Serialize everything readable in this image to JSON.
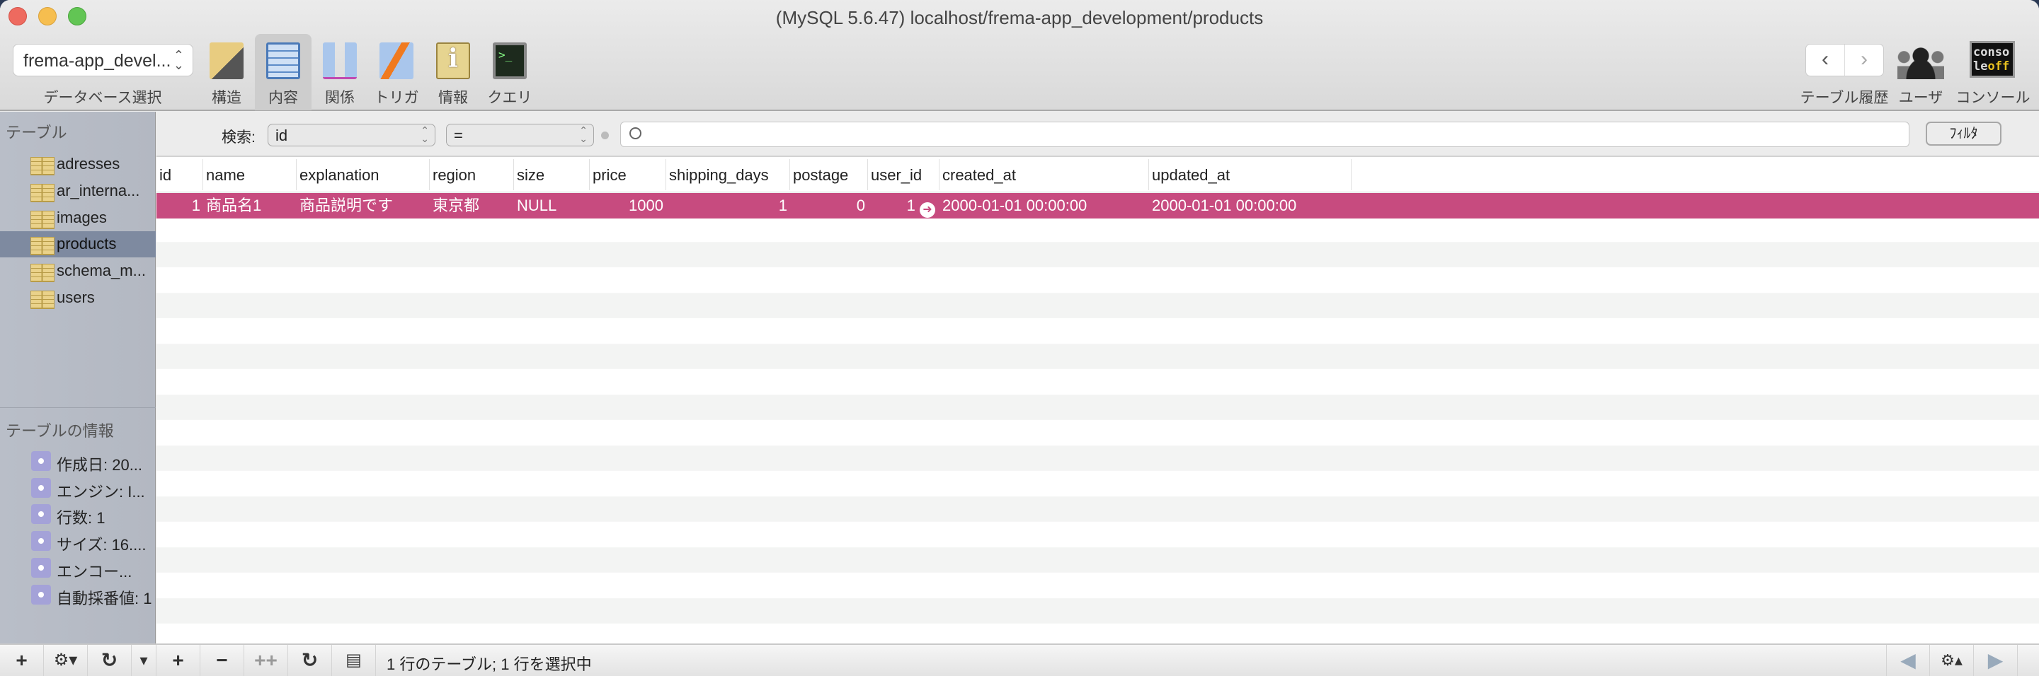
{
  "window": {
    "title": "(MySQL 5.6.47) localhost/frema-app_development/products"
  },
  "toolbar": {
    "database": "frema-app_devel...",
    "database_label": "データベース選択",
    "tools": [
      {
        "label": "構造"
      },
      {
        "label": "内容"
      },
      {
        "label": "関係"
      },
      {
        "label": "トリガ"
      },
      {
        "label": "情報"
      },
      {
        "label": "クエリ"
      }
    ],
    "history_label": "テーブル履歴",
    "users_label": "ユーザ",
    "console_label": "コンソール",
    "console_icon_line1": "conso",
    "console_icon_line2a": "le",
    "console_icon_line2b": "off"
  },
  "sidebar": {
    "tables_heading": "テーブル",
    "tables": [
      {
        "name": "adresses"
      },
      {
        "name": "ar_interna..."
      },
      {
        "name": "images"
      },
      {
        "name": "products"
      },
      {
        "name": "schema_m..."
      },
      {
        "name": "users"
      }
    ],
    "info_heading": "テーブルの情報",
    "info": [
      {
        "text": "作成日: 20..."
      },
      {
        "text": "エンジン: I..."
      },
      {
        "text": "行数: 1"
      },
      {
        "text": "サイズ: 16...."
      },
      {
        "text": "エンコー..."
      },
      {
        "text": "自動採番値: 1"
      }
    ]
  },
  "filter": {
    "label": "検索:",
    "field": "id",
    "operator": "=",
    "search_value": "",
    "button": "ﾌｨﾙﾀ"
  },
  "table": {
    "columns": [
      "id",
      "name",
      "explanation",
      "region",
      "size",
      "price",
      "shipping_days",
      "postage",
      "user_id",
      "created_at",
      "updated_at"
    ],
    "rows": [
      [
        "1",
        "商品名1",
        "商品説明です",
        "東京都",
        "NULL",
        "1000",
        "1",
        "0",
        "1",
        "2000-01-01 00:00:00",
        "2000-01-01 00:00:00"
      ]
    ]
  },
  "status": {
    "text": "1 行のテーブル; 1 行を選択中"
  },
  "colors": {
    "selected_row": "#c74b7f",
    "sidebar": "#b5bac4"
  }
}
